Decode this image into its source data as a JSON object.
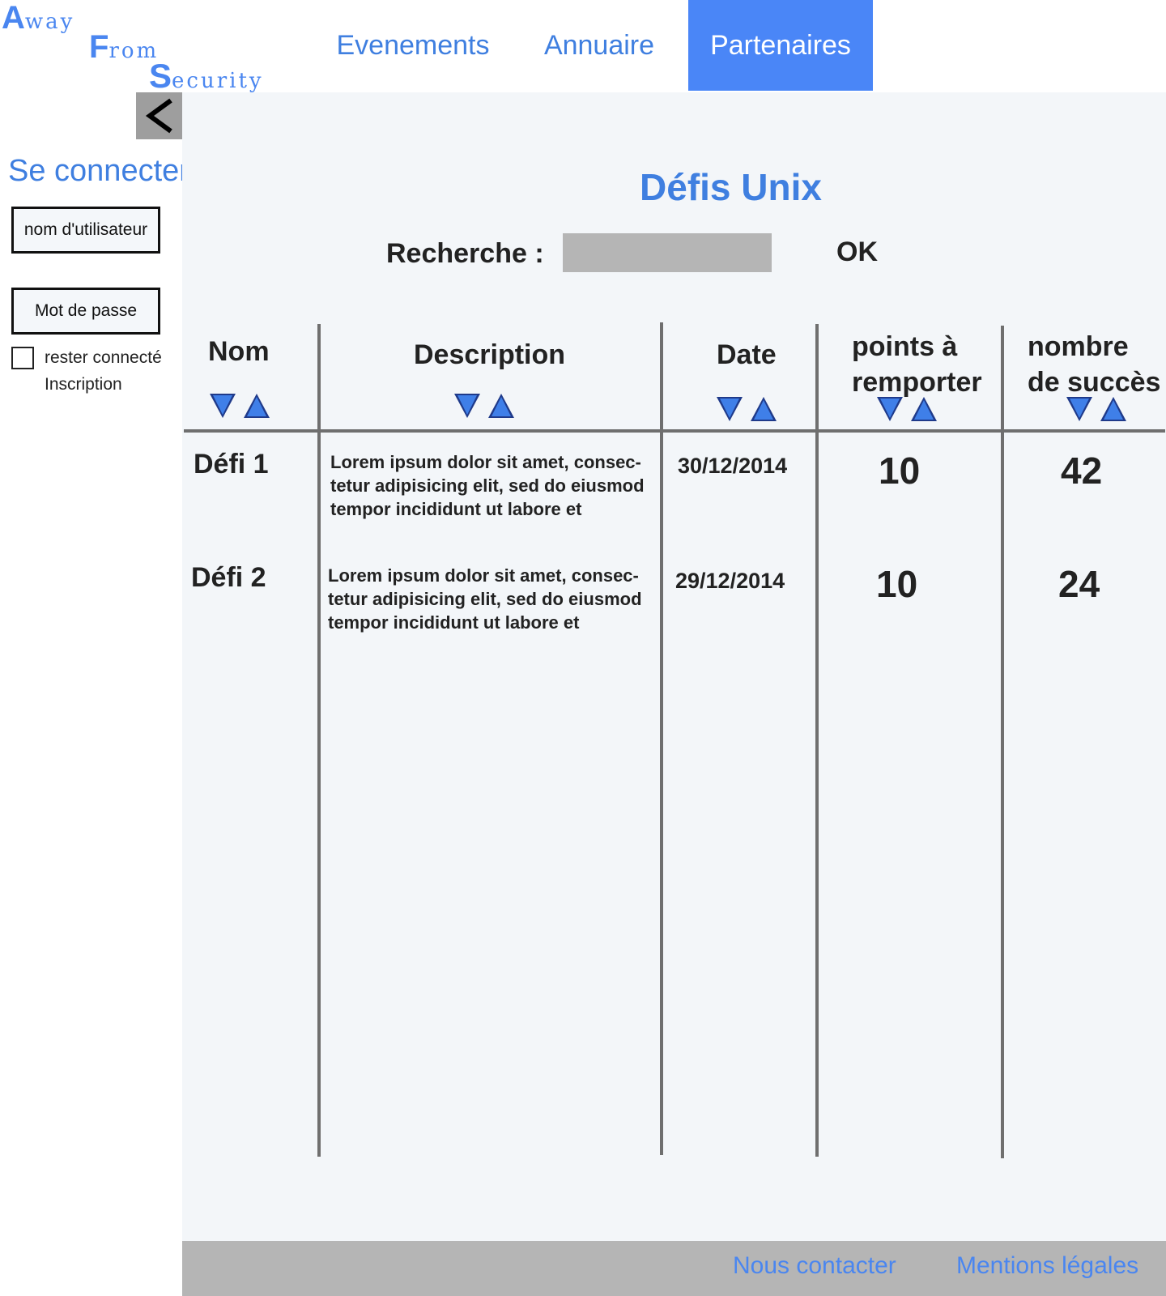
{
  "brand": {
    "line1_cap": "A",
    "line1_rest": "way",
    "line2_cap": "F",
    "line2_rest": "rom",
    "line3_cap": "S",
    "line3_rest": "ecurity"
  },
  "nav": {
    "events": "Evenements",
    "directory": "Annuaire",
    "partners": "Partenaires",
    "active": "Partenaires",
    "active_color": "#4a86f7"
  },
  "sidebar": {
    "collapse_icon": "chevron-left-icon",
    "login_title": "Se connecter",
    "username_placeholder": "nom d'utilisateur",
    "password_placeholder": "Mot de passe",
    "remember_label": "rester connecté",
    "remember_checked": false,
    "register_link": "Inscription"
  },
  "main": {
    "title": "Défis Unix",
    "search_label": "Recherche :",
    "search_value": "",
    "ok_label": "OK",
    "table": {
      "headers": [
        {
          "label": "Nom",
          "sort_icons": [
            "sort-down-icon",
            "sort-up-icon"
          ]
        },
        {
          "label": "Description",
          "sort_icons": [
            "sort-down-icon",
            "sort-up-icon"
          ]
        },
        {
          "label": "Date",
          "sort_icons": [
            "sort-down-icon",
            "sort-up-icon"
          ]
        },
        {
          "label_line1": "points à",
          "label_line2": "remporter",
          "sort_icons": [
            "sort-down-icon",
            "sort-up-icon"
          ]
        },
        {
          "label_line1": "nombre",
          "label_line2": "de succès",
          "sort_icons": [
            "sort-down-icon",
            "sort-up-icon"
          ]
        }
      ],
      "rows": [
        {
          "name": "Défi 1",
          "desc_line1": "Lorem ipsum dolor sit amet, consec-",
          "desc_line2": "tetur adipisicing elit, sed do eiusmod",
          "desc_line3": "tempor incididunt ut labore et",
          "date": "30/12/2014",
          "points": "10",
          "successes": "42"
        },
        {
          "name": "Défi 2",
          "desc_line1": "Lorem ipsum dolor sit amet, consec-",
          "desc_line2": "tetur adipisicing elit, sed do eiusmod",
          "desc_line3": "tempor incididunt ut labore et",
          "date": "29/12/2014",
          "points": "10",
          "successes": "24"
        }
      ]
    }
  },
  "footer": {
    "contact": "Nous contacter",
    "legal": "Mentions légales"
  },
  "colors": {
    "accent": "#3f7fe0",
    "main_bg": "#f3f6f9",
    "footer_bg": "#b5b5b5",
    "search_bg": "#b5b5b5"
  }
}
